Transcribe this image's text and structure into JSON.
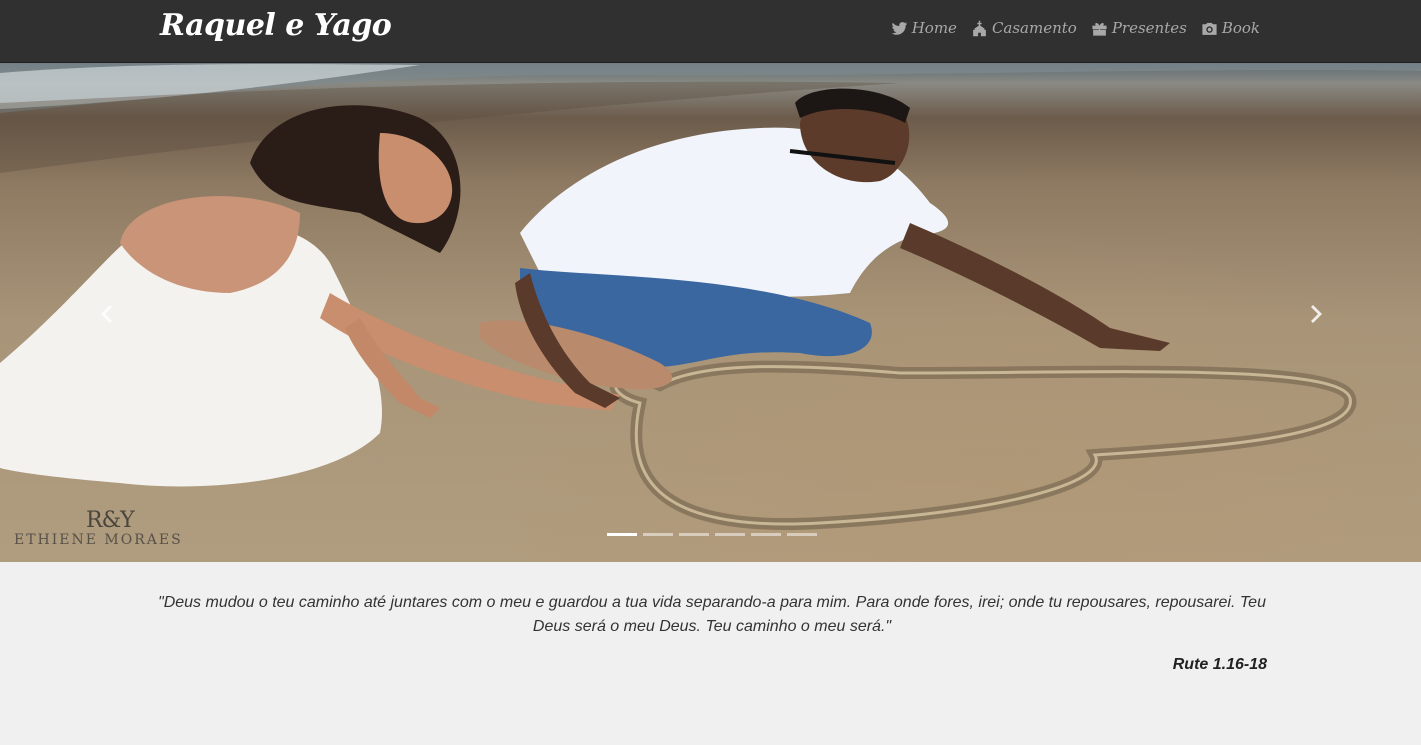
{
  "header": {
    "brand": "Raquel e Yago",
    "nav": [
      {
        "label": "Home",
        "icon": "twitter-bird-icon"
      },
      {
        "label": "Casamento",
        "icon": "church-icon"
      },
      {
        "label": "Presentes",
        "icon": "gift-icon"
      },
      {
        "label": "Book",
        "icon": "camera-icon"
      }
    ]
  },
  "carousel": {
    "slide_count": 6,
    "active_index": 0,
    "watermark": {
      "monogram": "R&Y",
      "name": "ETHIENE MORAES"
    }
  },
  "verse": {
    "text": "\"Deus mudou o teu caminho até juntares com o meu e guardou a tua vida separando-a para mim. Para onde fores, irei; onde tu repousares, repousarei. Teu Deus será o meu Deus. Teu caminho o meu será.\"",
    "reference": "Rute 1.16-18"
  },
  "colors": {
    "navbar_bg": "#303030",
    "nav_text": "#a8a8a8",
    "page_bg": "#f0f0f0"
  }
}
